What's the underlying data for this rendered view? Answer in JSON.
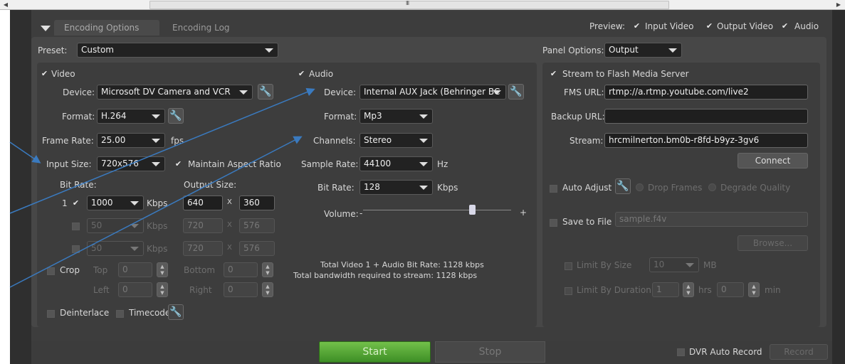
{
  "scrollbar": {
    "grip": "III",
    "left_arrow": "◀",
    "right_arrow": "▶"
  },
  "tabs": [
    {
      "label": "Encoding Options"
    },
    {
      "label": "Encoding Log"
    }
  ],
  "preview": {
    "label": "Preview:",
    "input_video": "Input Video",
    "output_video": "Output Video",
    "audio": "Audio"
  },
  "preset": {
    "label": "Preset:",
    "value": "Custom"
  },
  "panel_options": {
    "label": "Panel Options:",
    "value": "Output"
  },
  "video": {
    "header": "Video",
    "device_label": "Device:",
    "device_value": "Microsoft DV Camera and VCR",
    "format_label": "Format:",
    "format_value": "H.264",
    "frame_rate_label": "Frame Rate:",
    "frame_rate_value": "25.00",
    "frame_rate_unit": "fps",
    "input_size_label": "Input Size:",
    "input_size_value": "720x576",
    "maintain_aspect": "Maintain Aspect Ratio",
    "bit_rate_label": "Bit Rate:",
    "output_size_label": "Output Size:",
    "rows": [
      {
        "index": "1",
        "bitrate": "1000",
        "unit": "Kbps",
        "width": "640",
        "x": "X",
        "height": "360"
      },
      {
        "index": "",
        "bitrate": "50",
        "unit": "Kbps",
        "width": "720",
        "x": "X",
        "height": "576"
      },
      {
        "index": "",
        "bitrate": "50",
        "unit": "Kbps",
        "width": "720",
        "x": "X",
        "height": "576"
      }
    ],
    "crop": "Crop",
    "top": "Top",
    "bottom": "Bottom",
    "left": "Left",
    "right": "Right",
    "crop_top": "0",
    "crop_bottom": "0",
    "crop_left": "0",
    "crop_right": "0",
    "deinterlace": "Deinterlace",
    "timecode": "Timecode"
  },
  "audio": {
    "header": "Audio",
    "device_label": "Device:",
    "device_value": "Internal AUX Jack (Behringer BC",
    "format_label": "Format:",
    "format_value": "Mp3",
    "channels_label": "Channels:",
    "channels_value": "Stereo",
    "sample_rate_label": "Sample Rate:",
    "sample_rate_value": "44100",
    "sample_rate_unit": "Hz",
    "bit_rate_label": "Bit Rate:",
    "bit_rate_value": "128",
    "bit_rate_unit": "Kbps",
    "volume_label": "Volume:",
    "volume_minus": "-",
    "volume_plus": "+",
    "volume_level": 0.74,
    "total_line1": "Total Video 1 + Audio Bit Rate:  1128 kbps",
    "total_line2": "Total bandwidth required to stream:  1128 kbps"
  },
  "output": {
    "stream_fms": "Stream to Flash Media Server",
    "fms_url_label": "FMS URL:",
    "fms_url_value": "rtmp://a.rtmp.youtube.com/live2",
    "backup_url_label": "Backup URL:",
    "backup_url_value": "",
    "stream_label": "Stream:",
    "stream_value": "hrcmilnerton.bm0b-r8fd-b9yz-3gv6",
    "connect": "Connect",
    "auto_adjust": "Auto Adjust",
    "drop_frames": "Drop Frames",
    "degrade_quality": "Degrade Quality",
    "save_to_file": "Save to File",
    "save_placeholder": "sample.f4v",
    "browse": "Browse...",
    "limit_by_size": "Limit By Size",
    "size_value": "10",
    "size_unit": "MB",
    "limit_by_duration": "Limit By Duration",
    "hrs_value": "1",
    "hrs_unit": "hrs",
    "min_value": "0",
    "min_unit": "min"
  },
  "bottom": {
    "start": "Start",
    "stop": "Stop",
    "dvr_auto_record": "DVR Auto Record",
    "record": "Record"
  },
  "colors": {
    "start_green": "#5aab3a",
    "panel_bg": "#3d3d3d",
    "annotation_arrow": "#3a7abf"
  }
}
